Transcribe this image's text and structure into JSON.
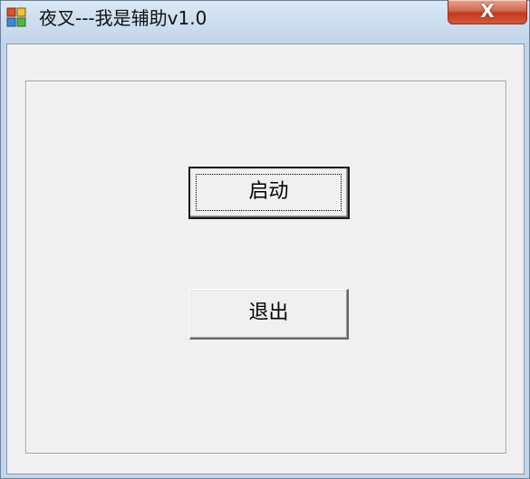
{
  "window": {
    "title": "夜叉---我是辅助v1.0",
    "icon": "app-icon",
    "close_symbol": "X"
  },
  "buttons": {
    "start_label": "启动",
    "exit_label": "退出"
  },
  "colors": {
    "client_bg": "#f0f0f0",
    "titlebar_bg": "#cfdff0",
    "close_button": "#c4391f"
  }
}
